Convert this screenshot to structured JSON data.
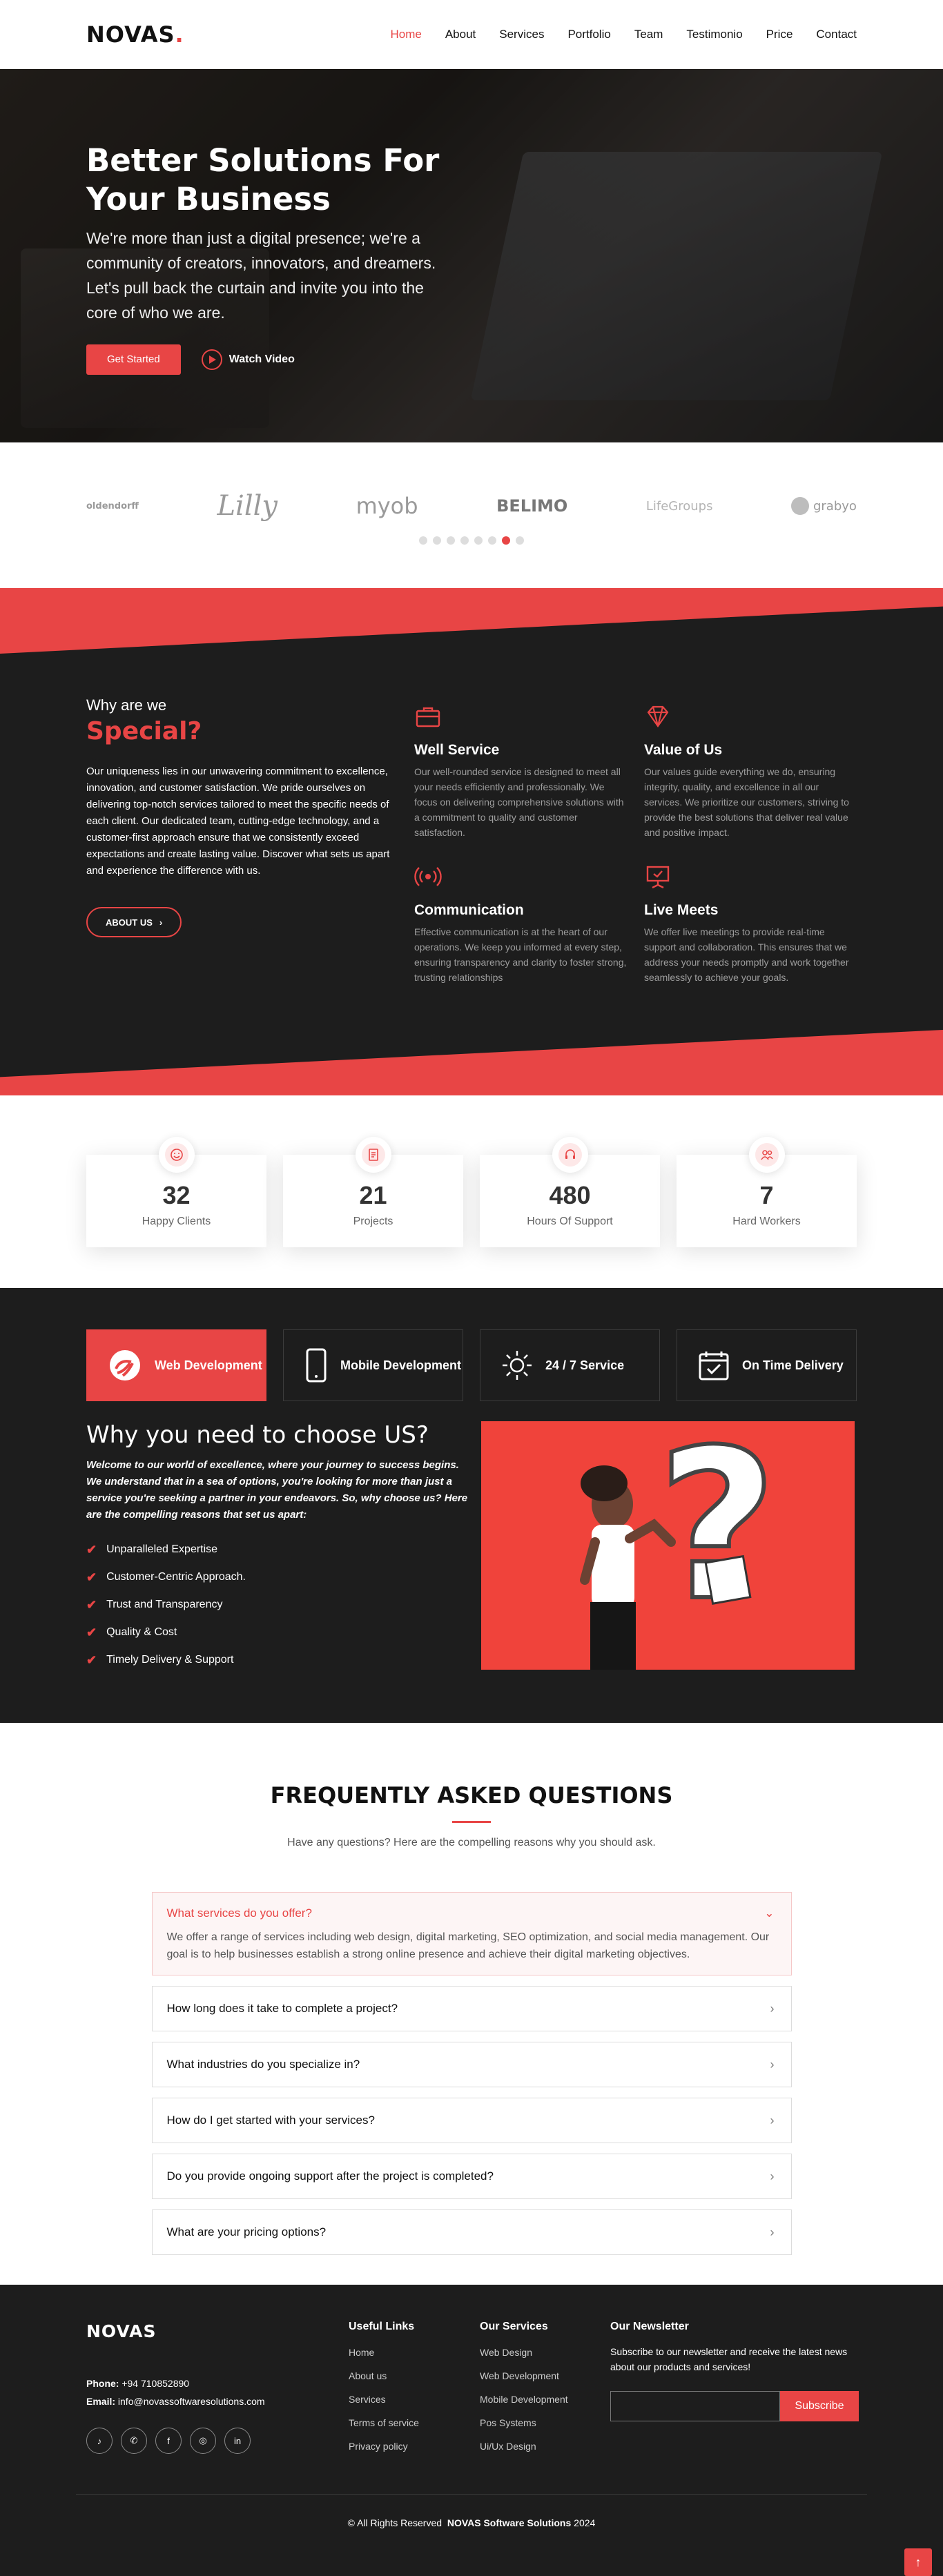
{
  "header": {
    "brand": "NOVAS",
    "brand_dot": ".",
    "nav": [
      "Home",
      "About",
      "Services",
      "Portfolio",
      "Team",
      "Testimonio",
      "Price",
      "Contact"
    ]
  },
  "hero": {
    "title": "Better Solutions For Your Business",
    "description": "We're more than just a digital presence; we're a community of creators, innovators, and dreamers. Let's pull back the curtain and invite you into the core of who we are.",
    "cta": "Get Started",
    "video_label": "Watch Video"
  },
  "clients": {
    "logos": [
      "oldendorff",
      "Lilly",
      "myob",
      "BELIMO",
      "LifeGroups",
      "grabyo"
    ],
    "dots_count": 8,
    "active_dot": 6
  },
  "why": {
    "pre_title": "Why are we",
    "title": "Special?",
    "body": "Our uniqueness lies in our unwavering commitment to excellence, innovation, and customer satisfaction. We pride ourselves on delivering top-notch services tailored to meet the specific needs of each client. Our dedicated team, cutting-edge technology, and a customer-first approach ensure that we consistently exceed expectations and create lasting value. Discover what sets us apart and experience the difference with us.",
    "button": "ABOUT US",
    "features": [
      {
        "title": "Well Service",
        "text": "Our well-rounded service is designed to meet all your needs efficiently and professionally. We focus on delivering comprehensive solutions with a commitment to quality and customer satisfaction.",
        "icon": "briefcase-icon"
      },
      {
        "title": "Value of Us",
        "text": "Our values guide everything we do, ensuring integrity, quality, and excellence in all our services. We prioritize our customers, striving to provide the best solutions that deliver real value and positive impact.",
        "icon": "diamond-icon"
      },
      {
        "title": "Communication",
        "text": "Effective communication is at the heart of our operations. We keep you informed at every step, ensuring transparency and clarity to foster strong, trusting relationships",
        "icon": "broadcast-icon"
      },
      {
        "title": "Live Meets",
        "text": "We offer live meetings to provide real-time support and collaboration. This ensures that we address your needs promptly and work together seamlessly to achieve your goals.",
        "icon": "presentation-icon"
      }
    ]
  },
  "counters": [
    {
      "value": "32",
      "label": "Happy Clients",
      "icon": "smile-icon"
    },
    {
      "value": "21",
      "label": "Projects",
      "icon": "document-icon"
    },
    {
      "value": "480",
      "label": "Hours Of Support",
      "icon": "headset-icon"
    },
    {
      "value": "7",
      "label": "Hard Workers",
      "icon": "people-icon"
    }
  ],
  "choose": {
    "tabs": [
      {
        "label": "Web Development",
        "icon": "web-icon"
      },
      {
        "label": "Mobile Development",
        "icon": "mobile-icon"
      },
      {
        "label": "24 / 7 Service",
        "icon": "sun-icon"
      },
      {
        "label": "On Time Delivery",
        "icon": "calendar-check-icon"
      }
    ],
    "title": "Why you need to choose US?",
    "intro": "Welcome to our world of excellence, where your journey to success begins. We understand that in a sea of options, you're looking for more than just a service you're seeking a partner in your endeavors. So, why choose us? Here are the compelling reasons that set us apart:",
    "list": [
      "Unparalleled Expertise",
      "Customer-Centric Approach.",
      "Trust and Transparency",
      "Quality & Cost",
      "Timely Delivery & Support"
    ],
    "check_glyph": "✔",
    "question_glyph": "?"
  },
  "faq": {
    "title": "FREQUENTLY ASKED QUESTIONS",
    "subtitle": "Have any questions? Here are the compelling reasons why you should ask.",
    "open": {
      "question": "What services do you offer?",
      "answer": "We offer a range of services including web design, digital marketing, SEO optimization, and social media management. Our goal is to help businesses establish a strong online presence and achieve their digital marketing objectives."
    },
    "items": [
      "How long does it take to complete a project?",
      "What industries do you specialize in?",
      "How do I get started with your services?",
      "Do you provide ongoing support after the project is completed?",
      "What are your pricing options?"
    ]
  },
  "footer": {
    "brand": "NOVAS",
    "phone_label": "Phone:",
    "phone": "+94 710852890",
    "email_label": "Email:",
    "email": "info@novassoftwaresolutions.com",
    "useful_title": "Useful Links",
    "useful_links": [
      "Home",
      "About us",
      "Services",
      "Terms of service",
      "Privacy policy"
    ],
    "services_title": "Our Services",
    "services": [
      "Web Design",
      "Web Development",
      "Mobile Development",
      "Pos Systems",
      "Ui/Ux Design"
    ],
    "newsletter_title": "Our Newsletter",
    "newsletter_text": "Subscribe to our newsletter and receive the latest news about our products and services!",
    "subscribe": "Subscribe",
    "copyright_prefix": "© All Rights Reserved",
    "copyright_company": "NOVAS Software Solutions",
    "copyright_year": "2024",
    "socials": [
      "tiktok-icon",
      "whatsapp-icon",
      "facebook-icon",
      "instagram-icon",
      "linkedin-icon"
    ]
  },
  "colors": {
    "accent": "#e84545",
    "dark": "#1d1d1d"
  }
}
